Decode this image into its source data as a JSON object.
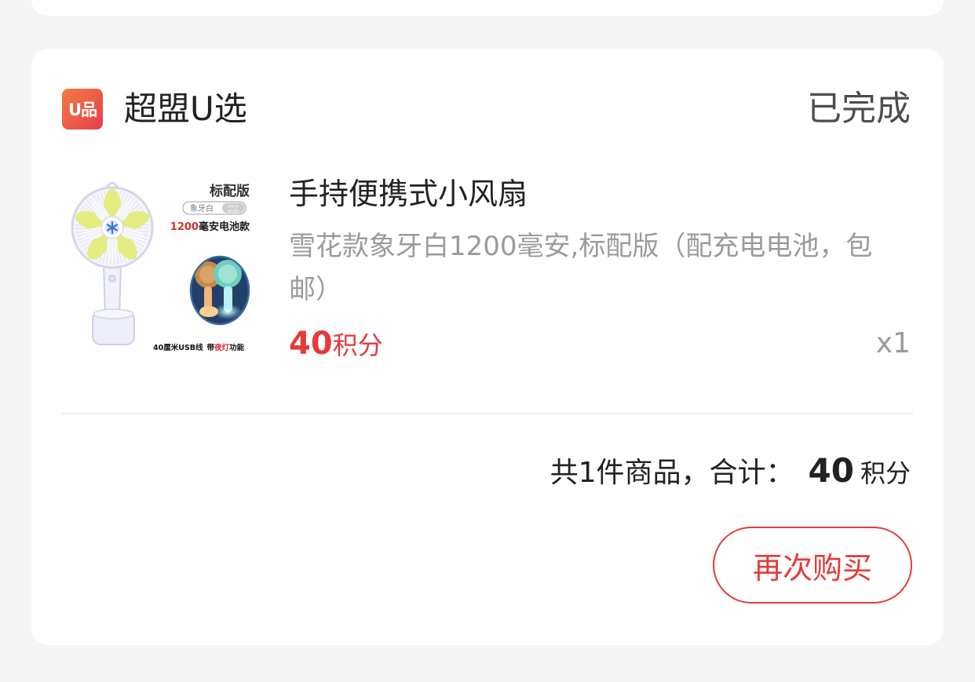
{
  "store": {
    "logo_text": "U品",
    "name": "超盟U选",
    "status": "已完成"
  },
  "product": {
    "title": "手持便携式小风扇",
    "spec": "雪花款象牙白1200毫安,标配版（配充电电池，包邮）",
    "price": {
      "value": "40",
      "unit": "积分"
    },
    "quantity": "x1",
    "image_labels": {
      "edition": "标配版",
      "color_cn": "象牙白",
      "color_en_line1": "ivory",
      "color_en_line2": "white",
      "battery_capacity": "1200",
      "battery_text": "毫安电池款",
      "cable": "40厘米USB线",
      "light_prefix": "带",
      "light_highlight": "夜灯",
      "light_suffix": "功能"
    }
  },
  "summary": {
    "count_text": "共1件商品，合计：",
    "total_value": "40",
    "total_unit": "积分"
  },
  "actions": {
    "rebuy": "再次购买"
  },
  "theme": {
    "background": "#f5f5f5",
    "card": "#ffffff",
    "text_primary": "#222222",
    "text_status": "#4d4d4d",
    "text_secondary": "#9b9b9b",
    "accent": "#e53a3a",
    "logo_gradient_start": "#f27b43",
    "logo_gradient_end": "#e6404b",
    "divider": "#ececec"
  }
}
